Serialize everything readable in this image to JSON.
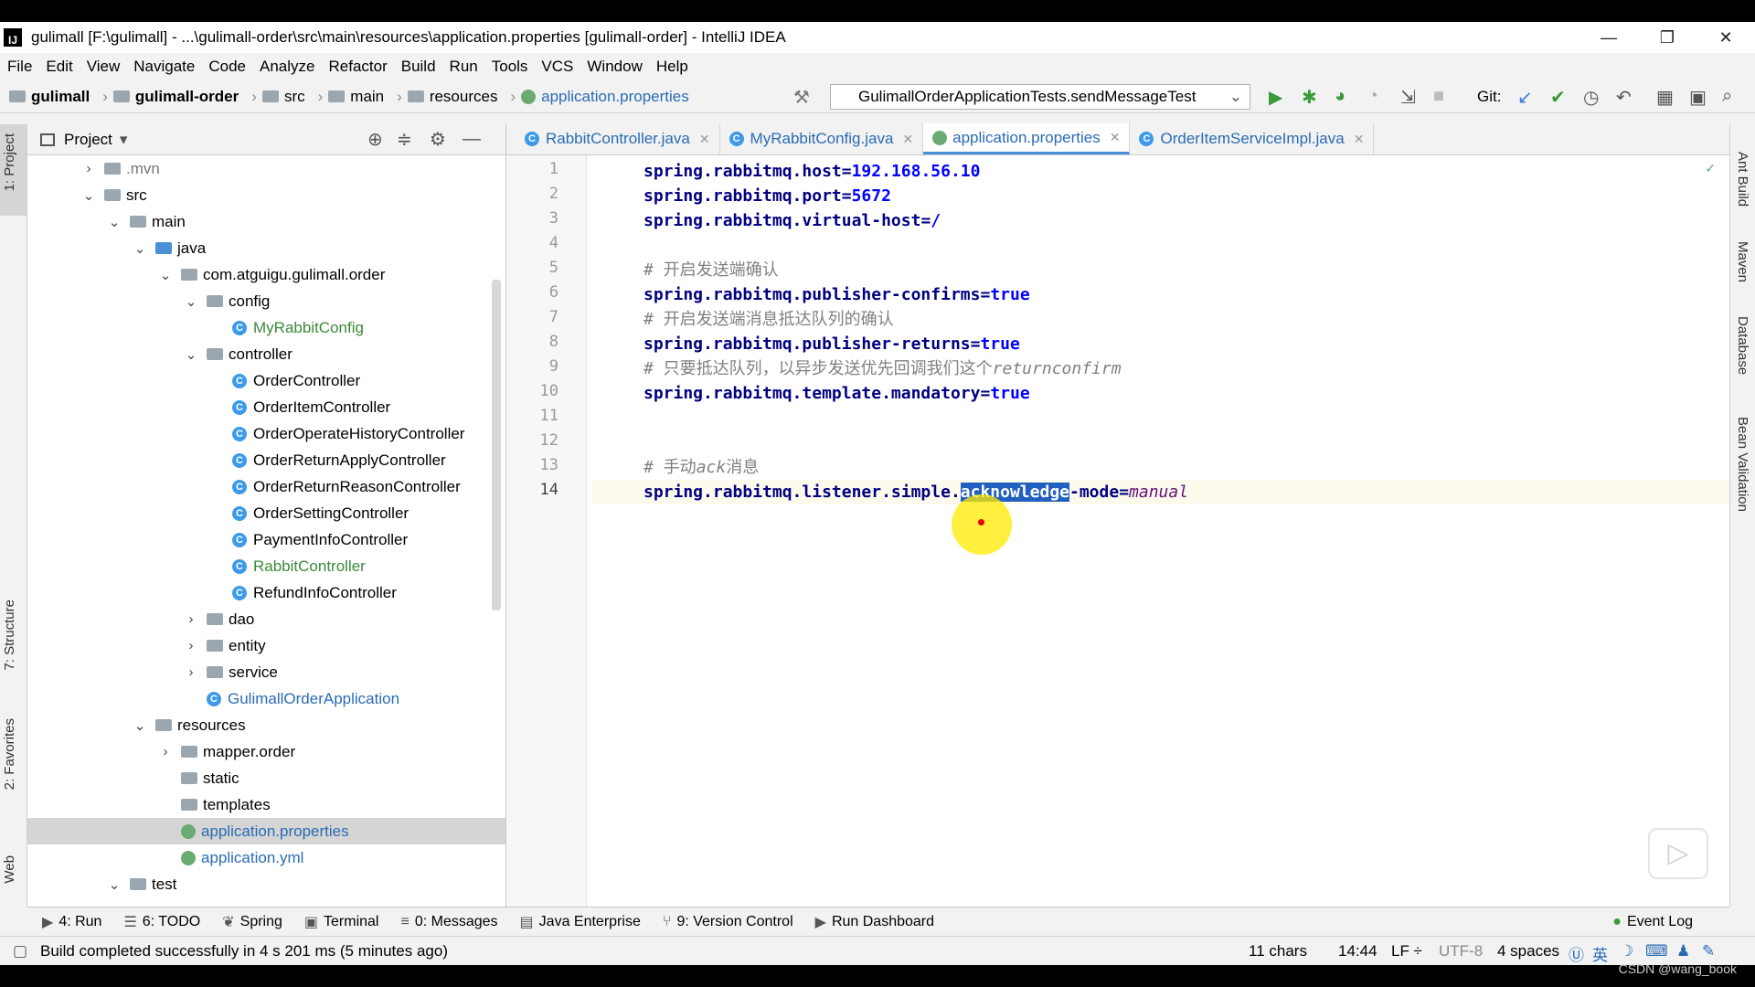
{
  "window": {
    "title": "gulimall [F:\\gulimall] - ...\\gulimall-order\\src\\main\\resources\\application.properties [gulimall-order] - IntelliJ IDEA",
    "logo": "IJ"
  },
  "menu": [
    "File",
    "Edit",
    "View",
    "Navigate",
    "Code",
    "Analyze",
    "Refactor",
    "Build",
    "Run",
    "Tools",
    "VCS",
    "Window",
    "Help"
  ],
  "breadcrumb": {
    "c1": "gulimall",
    "c2": "gulimall-order",
    "c3": "src",
    "c4": "main",
    "c5": "resources",
    "c6": "application.properties"
  },
  "run_config": "GulimallOrderApplicationTests.sendMessageTest",
  "git_label": "Git:",
  "project_panel": {
    "title": "Project"
  },
  "tree": [
    {
      "label": ".mvn"
    },
    {
      "label": "src"
    },
    {
      "label": "main"
    },
    {
      "label": "java"
    },
    {
      "label": "com.atguigu.gulimall.order"
    },
    {
      "label": "config"
    },
    {
      "label": "MyRabbitConfig"
    },
    {
      "label": "controller"
    },
    {
      "label": "OrderController"
    },
    {
      "label": "OrderItemController"
    },
    {
      "label": "OrderOperateHistoryController"
    },
    {
      "label": "OrderReturnApplyController"
    },
    {
      "label": "OrderReturnReasonController"
    },
    {
      "label": "OrderSettingController"
    },
    {
      "label": "PaymentInfoController"
    },
    {
      "label": "RabbitController"
    },
    {
      "label": "RefundInfoController"
    },
    {
      "label": "dao"
    },
    {
      "label": "entity"
    },
    {
      "label": "service"
    },
    {
      "label": "GulimallOrderApplication"
    },
    {
      "label": "resources"
    },
    {
      "label": "mapper.order"
    },
    {
      "label": "static"
    },
    {
      "label": "templates"
    },
    {
      "label": "application.properties"
    },
    {
      "label": "application.yml"
    },
    {
      "label": "test"
    }
  ],
  "tabs": [
    {
      "label": "RabbitController.java"
    },
    {
      "label": "MyRabbitConfig.java"
    },
    {
      "label": "application.properties"
    },
    {
      "label": "OrderItemServiceImpl.java"
    }
  ],
  "code": {
    "l1k": "spring.rabbitmq.host",
    "l1v": "192.168.56.10",
    "l2k": "spring.rabbitmq.port",
    "l2v": "5672",
    "l3k": "spring.rabbitmq.virtual-host",
    "l3v": "/",
    "l5": "# 开启发送端确认",
    "l6k": "spring.rabbitmq.publisher-confirms",
    "l6v": "true",
    "l7": "# 开启发送端消息抵达队列的确认",
    "l8k": "spring.rabbitmq.publisher-returns",
    "l8v": "true",
    "l9a": "# 只要抵达队列，以异步发送优先回调我们这个",
    "l9b": "returnconfirm",
    "l10k": "spring.rabbitmq.template.mandatory",
    "l10v": "true",
    "l13a": "# 手动",
    "l13b": "ack",
    "l13c": "消息",
    "l14a": "spring.rabbitmq.listener.simple.",
    "l14b": "acknowledge",
    "l14c": "-mode",
    "l14v": "manual"
  },
  "left_tools": [
    "1: Project",
    "7: Structure",
    "2: Favorites",
    "Web"
  ],
  "right_tools": [
    "Ant Build",
    "Maven",
    "Database",
    "Bean Validation"
  ],
  "bottom_tools": [
    {
      "label": "4: Run"
    },
    {
      "label": "6: TODO"
    },
    {
      "label": "Spring"
    },
    {
      "label": "Terminal"
    },
    {
      "label": "0: Messages"
    },
    {
      "label": "Java Enterprise"
    },
    {
      "label": "9: Version Control"
    },
    {
      "label": "Run Dashboard"
    },
    {
      "label": "Event Log"
    }
  ],
  "status": {
    "message": "Build completed successfully in 4 s 201 ms (5 minutes ago)",
    "chars": "11 chars",
    "position": "14:44",
    "line_sep": "LF ÷",
    "encoding": "UTF-8",
    "indent": "4 spaces",
    "ime": "英"
  },
  "watermark": "CSDN @wang_book"
}
